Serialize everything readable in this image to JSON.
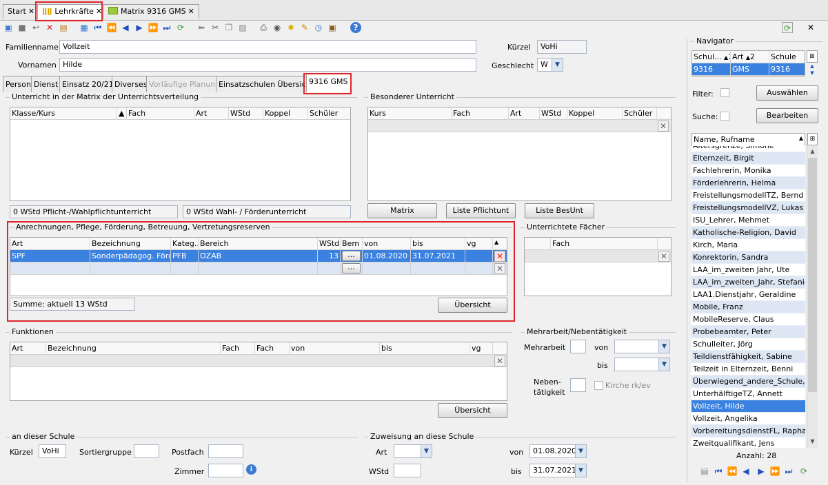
{
  "tabs": [
    {
      "label": "Start"
    },
    {
      "label": "Lehrkräfte"
    },
    {
      "label": "Matrix 9316 GMS"
    }
  ],
  "top_right": {
    "close": "✕"
  },
  "form": {
    "familienname_label": "Familienname",
    "familienname_value": "Vollzeit",
    "vornamen_label": "Vornamen",
    "vornamen_value": "Hilde",
    "kuerzel_label": "Kürzel",
    "kuerzel_value": "VoHi",
    "geschlecht_label": "Geschlecht",
    "geschlecht_value": "W"
  },
  "person_tabs": [
    "Person",
    "Dienst",
    "Einsatz 20/21",
    "Diverses",
    "Vorläufige Planung",
    "Einsatzschulen Übersicht",
    "9316 GMS"
  ],
  "unterricht": {
    "title": "Unterricht in der Matrix der Unterrichtsverteilung",
    "columns": [
      "Klasse/Kurs",
      "Fach",
      "Art",
      "WStd",
      "Koppel",
      "Schüler"
    ],
    "sum1": "0 WStd Pflicht-/Wahlpflichtunterricht",
    "sum2": "0 WStd Wahl- / Förderunterricht"
  },
  "besonderer": {
    "title": "Besonderer Unterricht",
    "columns": [
      "Kurs",
      "Fach",
      "Art",
      "WStd",
      "Koppel",
      "Schüler"
    ],
    "buttons": [
      "Matrix",
      "Liste Pflichtunt",
      "Liste BesUnt"
    ]
  },
  "anrechnungen": {
    "title": "Anrechnungen, Pflege, Förderung, Betreuung, Vertretungsreserven",
    "columns": [
      "Art",
      "Bezeichnung",
      "Kateg...",
      "Bereich",
      "WStd",
      "Bem",
      "von",
      "bis",
      "vg"
    ],
    "row": {
      "art": "SPF",
      "bezeichnung": "Sonderpädagog. Förde...",
      "kateg": "PFB",
      "bereich": "OZAB",
      "wstd": "13",
      "bem": "...",
      "von": "01.08.2020",
      "bis": "31.07.2021"
    },
    "empty_bem": "...",
    "summe": "Summe: aktuell 13 WStd",
    "button": "Übersicht"
  },
  "faecher": {
    "title": "Unterrichtete Fächer",
    "columns": [
      "Fach"
    ]
  },
  "funktionen": {
    "title": "Funktionen",
    "columns": [
      "Art",
      "Bezeichnung",
      "Fach",
      "Fach",
      "von",
      "bis",
      "vg"
    ],
    "button": "Übersicht"
  },
  "mehrarbeit": {
    "title": "Mehrarbeit/Nebentätigkeit",
    "mehrarbeit_label": "Mehrarbeit",
    "von_label": "von",
    "bis_label": "bis",
    "neben_label1": "Neben-",
    "neben_label2": "tätigkeit",
    "kirche_label": "Kirche rk/ev"
  },
  "schule": {
    "title": "an dieser Schule",
    "kuerzel_label": "Kürzel",
    "kuerzel_value": "VoHi",
    "sortier_label": "Sortiergruppe",
    "postfach_label": "Postfach",
    "zimmer_label": "Zimmer"
  },
  "zuweisung": {
    "title": "Zuweisung an diese Schule",
    "art_label": "Art",
    "wstd_label": "WStd",
    "von_label": "von",
    "von_value": "01.08.2020",
    "bis_label": "bis",
    "bis_value": "31.07.2021"
  },
  "navigator": {
    "title": "Navigator",
    "columns": [
      "Schul...",
      "Art",
      "Schule"
    ],
    "sort_marks": [
      "1",
      "2"
    ],
    "row": [
      "9316",
      "GMS",
      "9316"
    ],
    "filter_label": "Filter:",
    "suche_label": "Suche:",
    "btn_auswaehlen": "Auswählen",
    "btn_bearbeiten": "Bearbeiten",
    "list_header": "Name, Rufname",
    "items": [
      "Altersgrenze, Simone",
      "Elternzeit, Birgit",
      "Fachlehrerin, Monika",
      "Förderlehrerin, Helma",
      "FreistellungsmodellTZ, Bernd",
      "FreistellungsmodellVZ, Lukas",
      "ISU_Lehrer, Mehmet",
      "Katholische-Religion, David",
      "Kirch, Maria",
      "Konrektorin, Sandra",
      "LAA_im_zweiten Jahr, Ute",
      "LAA_im_zweiten_Jahr, Stefanie",
      "LAA1.Dienstjahr, Geraldine",
      "Mobile, Franz",
      "MobileReserve, Claus",
      "Probebeamter, Peter",
      "Schulleiter, Jörg",
      "Teildienstfähigkeit, Sabine",
      "Teilzeit in Elternzeit, Benni",
      "Überwiegend_andere_Schule, Ju...",
      "UnterhälftigeTZ, Annett",
      "Vollzeit, Hilde",
      "Vollzeit, Angelika",
      "VorbereitungsdienstFL, Raphaela",
      "Zweitqualifikant, Jens"
    ],
    "selected": "Vollzeit, Hilde",
    "count": "Anzahl: 28"
  },
  "colors": {
    "accent": "#3b82e0",
    "highlight": "#e0242c",
    "row_alt": "#dde6f3"
  }
}
